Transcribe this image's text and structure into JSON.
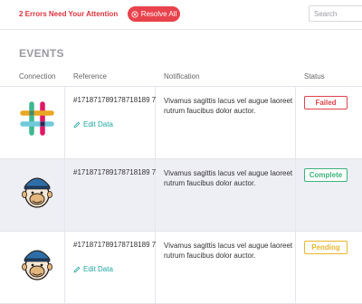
{
  "topbar": {
    "error_message": "2 Errors Need Your Attention",
    "resolve_label": "Resolve All",
    "search_placeholder": "Search"
  },
  "events": {
    "title": "EVENTS",
    "columns": {
      "connection": "Connection",
      "reference": "Reference",
      "notification": "Notification",
      "status": "Status"
    },
    "rows": [
      {
        "connection": "slack-logo",
        "reference": "#171871789178718189 7",
        "edit_label": "Edit Data",
        "notification": "Vivamus sagittis lacus vel augue laoreet rutrum faucibus dolor auctor.",
        "status": "Failed",
        "status_color": "#e0434c"
      },
      {
        "connection": "mailchimp-logo",
        "reference": "#171871789178718189 7",
        "notification": "Vivamus sagittis lacus vel augue laoreet rutrum faucibus dolor auctor.",
        "status": "Complete",
        "status_color": "#3bb37a"
      },
      {
        "connection": "mailchimp-logo",
        "reference": "#171871789178718189 7",
        "edit_label": "Edit Data",
        "notification": "Vivamus sagittis lacus vel augue laoreet rutrum faucibus dolor auctor.",
        "status": "Pending",
        "status_color": "#e8b72c"
      }
    ]
  },
  "colors": {
    "error": "#d9343f",
    "accent": "#1fa6a0",
    "row_highlight": "#eeeef5"
  }
}
